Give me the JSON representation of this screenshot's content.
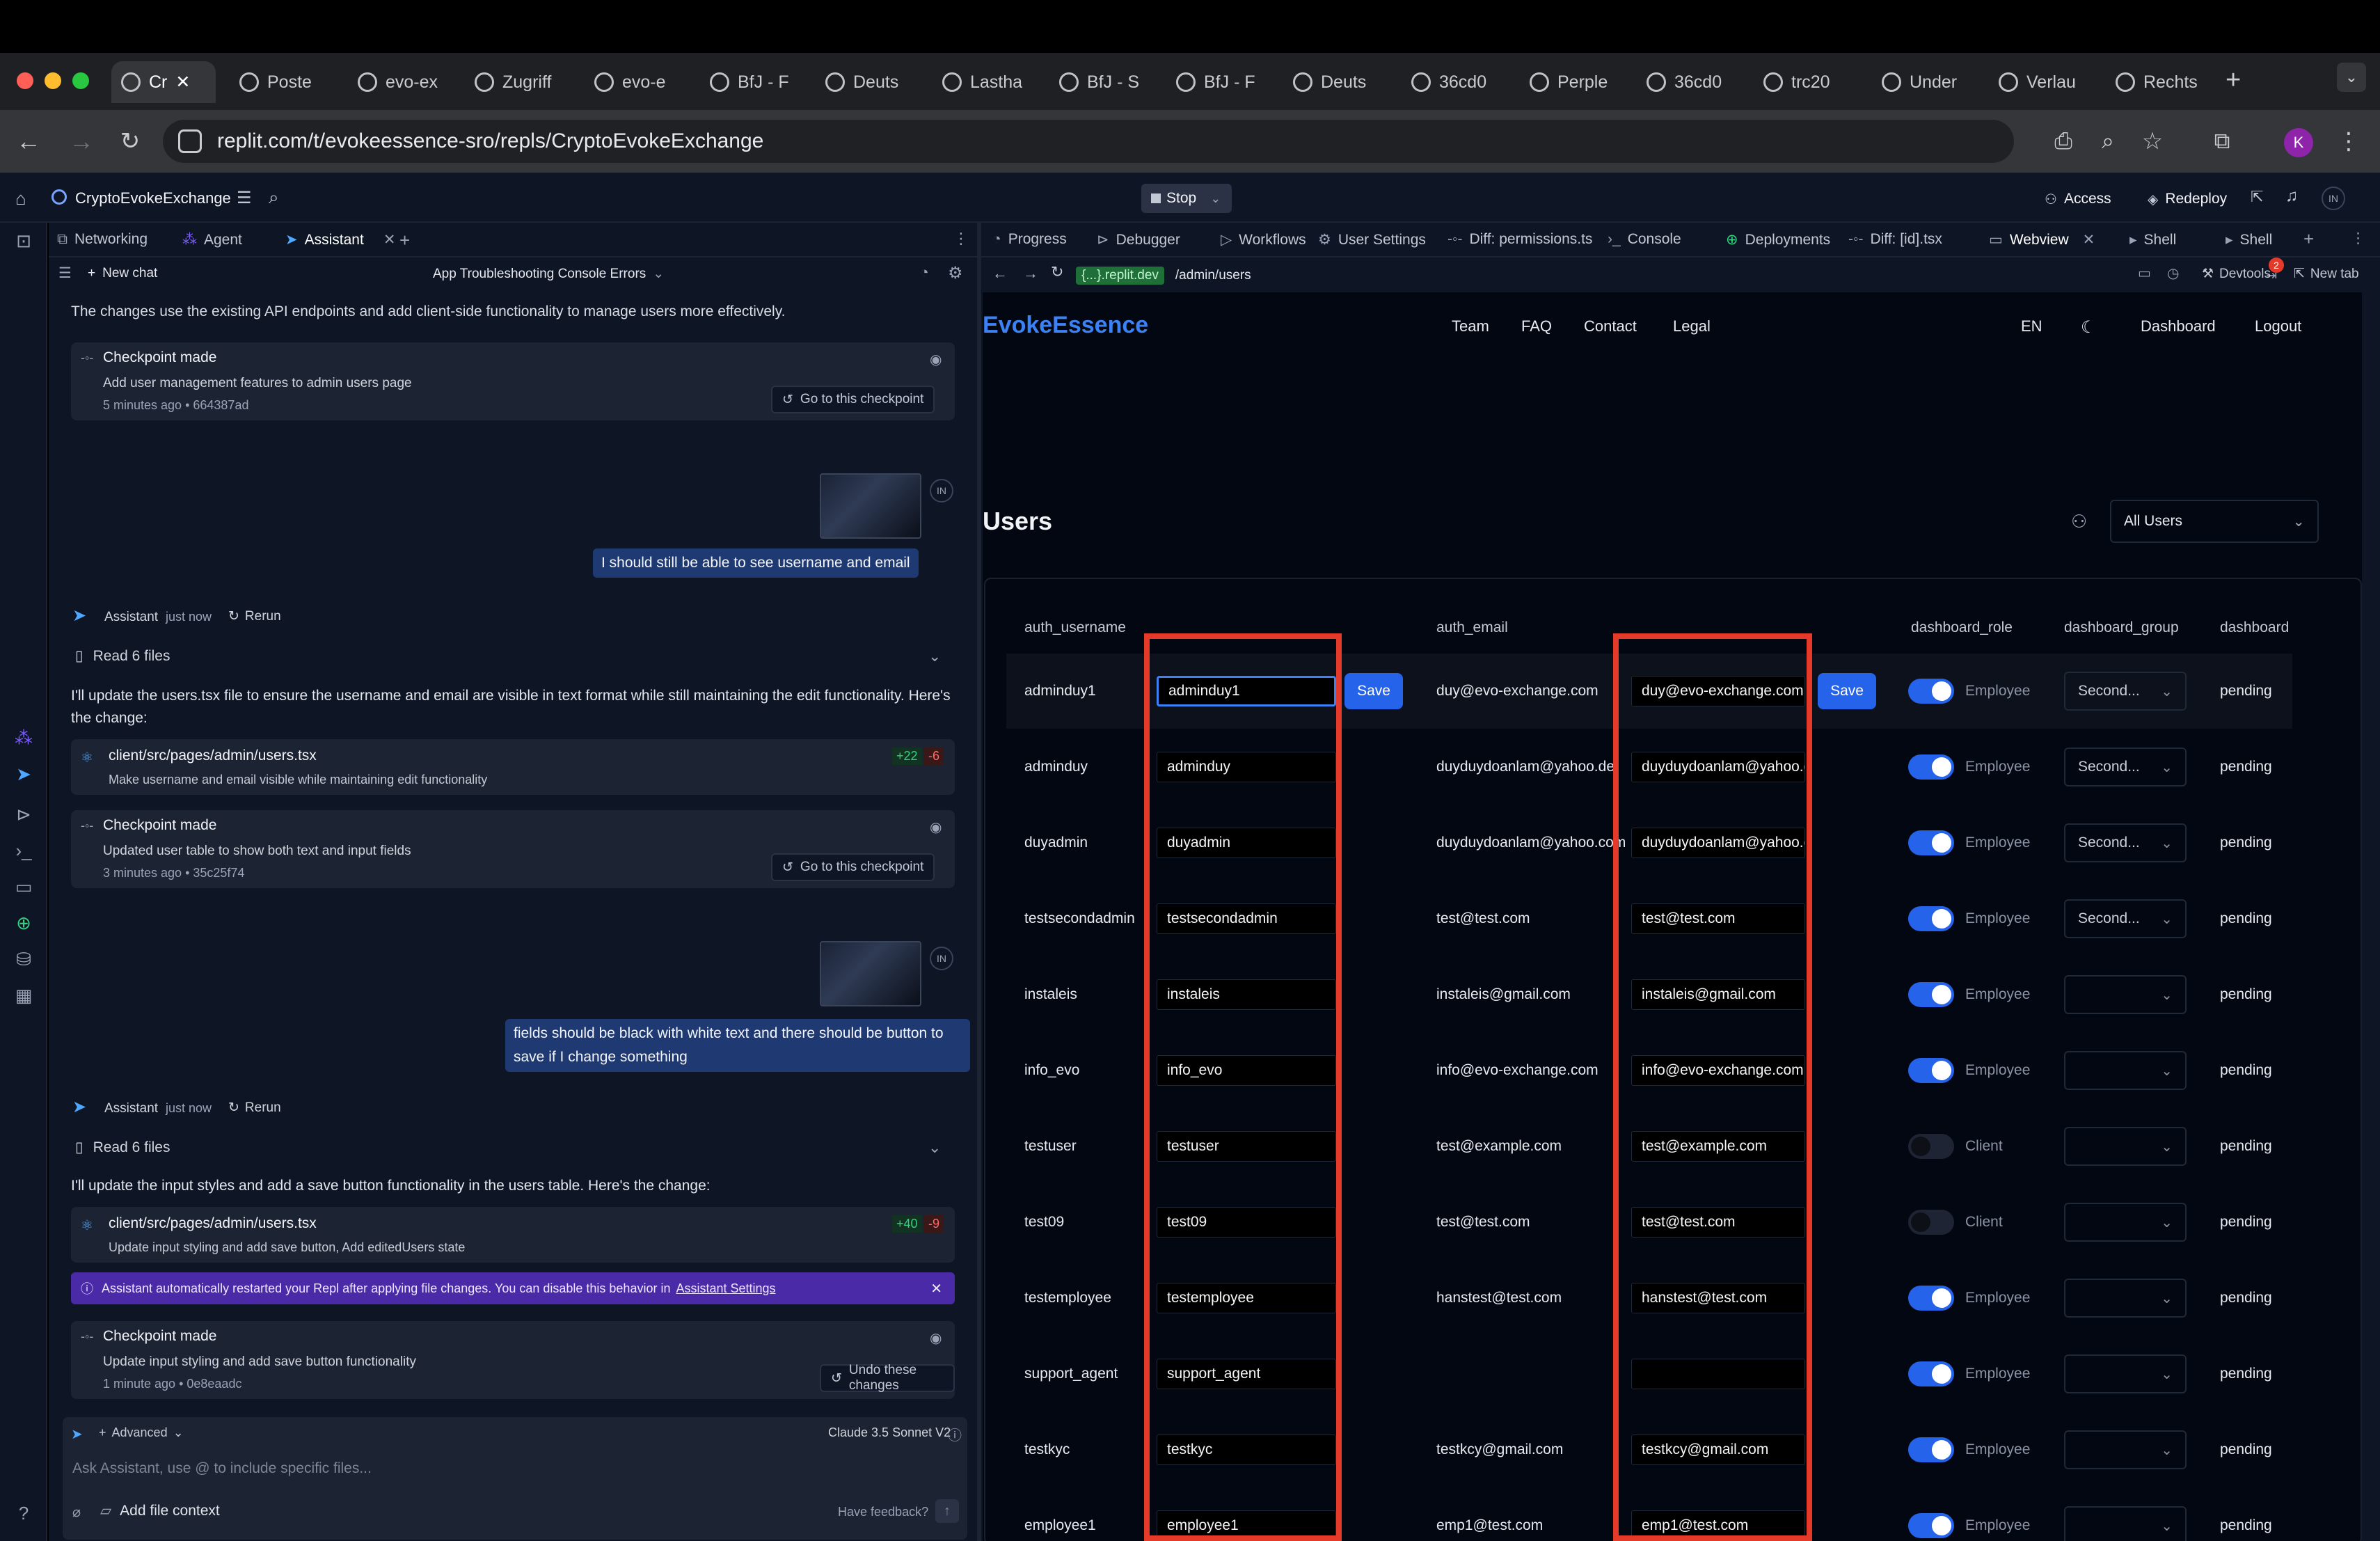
{
  "browser": {
    "tabs": [
      "Cr",
      "Poste",
      "evo-ex",
      "Zugriff",
      "evo-e",
      "BfJ - F",
      "Deuts",
      "Lastha",
      "BfJ - S",
      "BfJ - F",
      "Deuts",
      "36cd0",
      "Perple",
      "36cd0",
      "trc20",
      "Under",
      "Verlau",
      "Rechts"
    ],
    "url": "replit.com/t/evokeessence-sro/repls/CryptoEvokeExchange",
    "profile_initial": "K"
  },
  "replit": {
    "repl_name": "CryptoEvokeExchange",
    "stop_label": "Stop",
    "access_label": "Access",
    "redeploy_label": "Redeploy",
    "user_initials": "IN"
  },
  "left_tabs": [
    "Networking",
    "Agent",
    "Assistant"
  ],
  "chat": {
    "new_chat": "New chat",
    "title": "App Troubleshooting Console Errors",
    "intro": "The changes use the existing API endpoints and add client-side functionality to manage users more effectively.",
    "checkpoint1": {
      "title": "Checkpoint made",
      "desc": "Add user management features to admin users page",
      "meta": "5 minutes ago  • 664387ad",
      "action": "Go to this checkpoint"
    },
    "user_msg1": "I should still be able to see username and email",
    "assistant_label": "Assistant",
    "just_now": "just now",
    "rerun": "Rerun",
    "read_files": "Read 6 files",
    "reply1": "I'll update the users.tsx file to ensure the username and email are visible in text format while still maintaining the edit functionality. Here's the change:",
    "file1": {
      "path": "client/src/pages/admin/users.tsx",
      "desc": "Make username and email visible while maintaining edit functionality",
      "add": "+22",
      "del": "-6"
    },
    "checkpoint2": {
      "title": "Checkpoint made",
      "desc": "Updated user table to show both text and input fields",
      "meta": "3 minutes ago  • 35c25f74",
      "action": "Go to this checkpoint"
    },
    "user_msg2": "fields should be black with white text and there should be button to save if I change something",
    "reply2": "I'll update the input styles and add a save button functionality in the users table. Here's the change:",
    "file2": {
      "path": "client/src/pages/admin/users.tsx",
      "desc": "Update input styling and add save button, Add editedUsers state",
      "add": "+40",
      "del": "-9"
    },
    "notice": "Assistant automatically restarted your Repl after applying file changes. You can disable this behavior in",
    "notice_link": "Assistant Settings",
    "checkpoint3": {
      "title": "Checkpoint made",
      "desc": "Update input styling and add save button functionality",
      "meta": "1 minute ago  • 0e8eaadc",
      "action": "Undo these changes"
    },
    "advanced": "Advanced",
    "model": "Claude 3.5 Sonnet V2",
    "input_placeholder": "Ask Assistant, use @ to include specific files...",
    "add_file_context": "Add file context",
    "have_feedback": "Have feedback?"
  },
  "right_tabs": [
    "Progress",
    "Debugger",
    "Workflows",
    "User Settings",
    "Diff: permissions.ts",
    "Console",
    "Deployments",
    "Diff: [id].tsx",
    "Webview",
    "Shell",
    "Shell"
  ],
  "webview_bar": {
    "host": "{...}.replit.dev",
    "path": "/admin/users",
    "devtools": "Devtools",
    "devtools_badge": "2",
    "new_tab": "New tab"
  },
  "site": {
    "brand": "EvokeEssence",
    "nav": [
      "Team",
      "FAQ",
      "Contact",
      "Legal"
    ],
    "lang": "EN",
    "dashboard": "Dashboard",
    "logout": "Logout",
    "page_title": "Users",
    "filter": "All Users",
    "save": "Save",
    "columns": [
      "auth_username",
      "auth_email",
      "dashboard_role",
      "dashboard_group",
      "dashboard"
    ],
    "users": [
      {
        "username": "adminduy1",
        "username_input": "adminduy1",
        "email": "duy@evo-exchange.com",
        "email_input": "duy@evo-exchange.com",
        "role_on": true,
        "role": "Employee",
        "group": "Second...",
        "status": "pending"
      },
      {
        "username": "adminduy",
        "username_input": "adminduy",
        "email": "duyduydoanlam@yahoo.de",
        "email_input": "duyduydoanlam@yahoo.de",
        "role_on": true,
        "role": "Employee",
        "group": "Second...",
        "status": "pending"
      },
      {
        "username": "duyadmin",
        "username_input": "duyadmin",
        "email": "duyduydoanlam@yahoo.com",
        "email_input": "duyduydoanlam@yahoo.com",
        "role_on": true,
        "role": "Employee",
        "group": "Second...",
        "status": "pending"
      },
      {
        "username": "testsecondadmin",
        "username_input": "testsecondadmin",
        "email": "test@test.com",
        "email_input": "test@test.com",
        "role_on": true,
        "role": "Employee",
        "group": "Second...",
        "status": "pending"
      },
      {
        "username": "instaleis",
        "username_input": "instaleis",
        "email": "instaleis@gmail.com",
        "email_input": "instaleis@gmail.com",
        "role_on": true,
        "role": "Employee",
        "group": "",
        "status": "pending"
      },
      {
        "username": "info_evo",
        "username_input": "info_evo",
        "email": "info@evo-exchange.com",
        "email_input": "info@evo-exchange.com",
        "role_on": true,
        "role": "Employee",
        "group": "",
        "status": "pending"
      },
      {
        "username": "testuser",
        "username_input": "testuser",
        "email": "test@example.com",
        "email_input": "test@example.com",
        "role_on": false,
        "role": "Client",
        "group": "",
        "status": "pending"
      },
      {
        "username": "test09",
        "username_input": "test09",
        "email": "test@test.com",
        "email_input": "test@test.com",
        "role_on": false,
        "role": "Client",
        "group": "",
        "status": "pending"
      },
      {
        "username": "testemployee",
        "username_input": "testemployee",
        "email": "hanstest@test.com",
        "email_input": "hanstest@test.com",
        "role_on": true,
        "role": "Employee",
        "group": "",
        "status": "pending"
      },
      {
        "username": "support_agent",
        "username_input": "support_agent",
        "email": "",
        "email_input": "",
        "role_on": true,
        "role": "Employee",
        "group": "",
        "status": "pending"
      },
      {
        "username": "testkyc",
        "username_input": "testkyc",
        "email": "testkcy@gmail.com",
        "email_input": "testkcy@gmail.com",
        "role_on": true,
        "role": "Employee",
        "group": "",
        "status": "pending"
      },
      {
        "username": "employee1",
        "username_input": "employee1",
        "email": "emp1@test.com",
        "email_input": "emp1@test.com",
        "role_on": true,
        "role": "Employee",
        "group": "",
        "status": "pending"
      }
    ]
  },
  "colors": {
    "accent": "#2563eb",
    "brand": "#3b82f6",
    "annotation_red": "#e5392a",
    "app_bg": "#0e1525",
    "site_bg": "#030712"
  }
}
